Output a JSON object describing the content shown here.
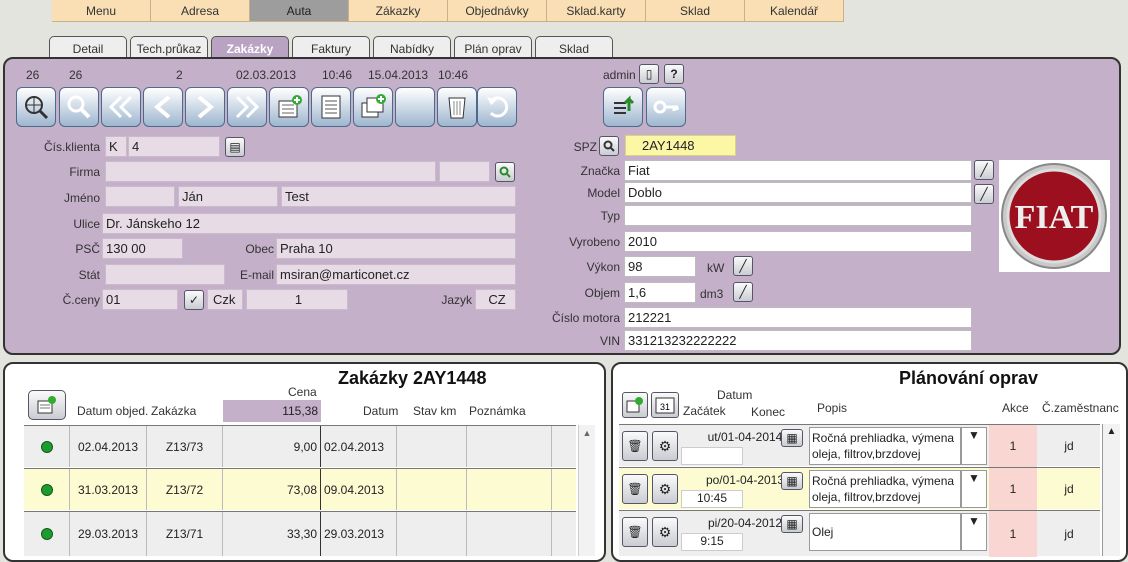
{
  "menu": [
    "Menu",
    "Adresa",
    "Auta",
    "Zákazky",
    "Objednávky",
    "Sklad.karty",
    "Sklad",
    "Kalendář"
  ],
  "menu_active": "Auta",
  "tabs": [
    "Detail",
    "Tech.průkaz",
    "Zakázky",
    "Faktury",
    "Nabídky",
    "Plán oprav",
    "Sklad"
  ],
  "tabs_active": "Zakázky",
  "header_info": {
    "n1": "26",
    "n2": "26",
    "n3": "2",
    "date1": "02.03.2013",
    "time1": "10:46",
    "date2": "15.04.2013",
    "time2": "10:46",
    "user": "admin"
  },
  "customer": {
    "cislo_label": "Čís.klienta",
    "cislo_type": "K",
    "cislo_value": "4",
    "firma_label": "Firma",
    "firma_value": "",
    "jmeno_label": "Jméno",
    "jmeno_title": "",
    "jmeno_first": "Ján",
    "jmeno_last": "Test",
    "ulice_label": "Ulice",
    "ulice_value": "Dr. Jánskeho 12",
    "psc_label": "PSČ",
    "psc_value": "130 00",
    "obec_label": "Obec",
    "obec_value": "Praha 10",
    "stat_label": "Stát",
    "stat_value": "",
    "email_label": "E-mail",
    "email_value": "msiran@marticonet.cz",
    "ceny_label": "Č.ceny",
    "ceny_value": "01",
    "currency": "Czk",
    "ceny_num": "1",
    "jazyk_label": "Jazyk",
    "jazyk_value": "CZ"
  },
  "vehicle": {
    "spz_label": "SPZ",
    "spz_value": "2AY1448",
    "znacka_label": "Značka",
    "znacka_value": "Fiat",
    "model_label": "Model",
    "model_value": "Doblo",
    "typ_label": "Typ",
    "typ_value": "",
    "vyrobeno_label": "Vyrobeno",
    "vyrobeno_value": "2010",
    "vykon_label": "Výkon",
    "vykon_value": "98",
    "vykon_unit": "kW",
    "objem_label": "Objem",
    "objem_value": "1,6",
    "objem_unit": "dm3",
    "motor_label": "Číslo motora",
    "motor_value": "212221",
    "vin_label": "VIN",
    "vin_value": "331213232222222",
    "logo_text": "FIAT"
  },
  "orders": {
    "title": "Zakázky 2AY1448",
    "col_datum_obj": "Datum objed.",
    "col_zakazka": "Zakázka",
    "col_cena": "Cena",
    "cena_total": "115,38",
    "col_datum": "Datum",
    "col_stav": "Stav km",
    "col_poznamka": "Poznámka",
    "rows": [
      {
        "datum_obj": "02.04.2013",
        "zakazka": "Z13/73",
        "cena": "9,00",
        "datum": "02.04.2013",
        "stav": "",
        "poznamka": ""
      },
      {
        "datum_obj": "31.03.2013",
        "zakazka": "Z13/72",
        "cena": "73,08",
        "datum": "09.04.2013",
        "stav": "",
        "poznamka": ""
      },
      {
        "datum_obj": "29.03.2013",
        "zakazka": "Z13/71",
        "cena": "33,30",
        "datum": "29.03.2013",
        "stav": "",
        "poznamka": ""
      }
    ]
  },
  "planning": {
    "title": "Plánování oprav",
    "col_datum": "Datum",
    "col_zacatek": "Začátek",
    "col_konec": "Konec",
    "col_popis": "Popis",
    "col_akce": "Akce",
    "col_zam": "Č.zaměstnanc",
    "rows": [
      {
        "date": "ut/01-04-2014",
        "time": "",
        "popis1": "Ročná prehliadka, výmena",
        "popis2": "oleja, filtrov,brzdovej",
        "akce": "1",
        "zam": "jd"
      },
      {
        "date": "po/01-04-2013",
        "time": "10:45",
        "popis1": "Ročná prehliadka, výmena",
        "popis2": "oleja, filtrov,brzdovej",
        "akce": "1",
        "zam": "jd"
      },
      {
        "date": "pi/20-04-2012",
        "time": "9:15",
        "popis1": "Olej",
        "popis2": "",
        "akce": "1",
        "zam": "jd"
      }
    ]
  }
}
